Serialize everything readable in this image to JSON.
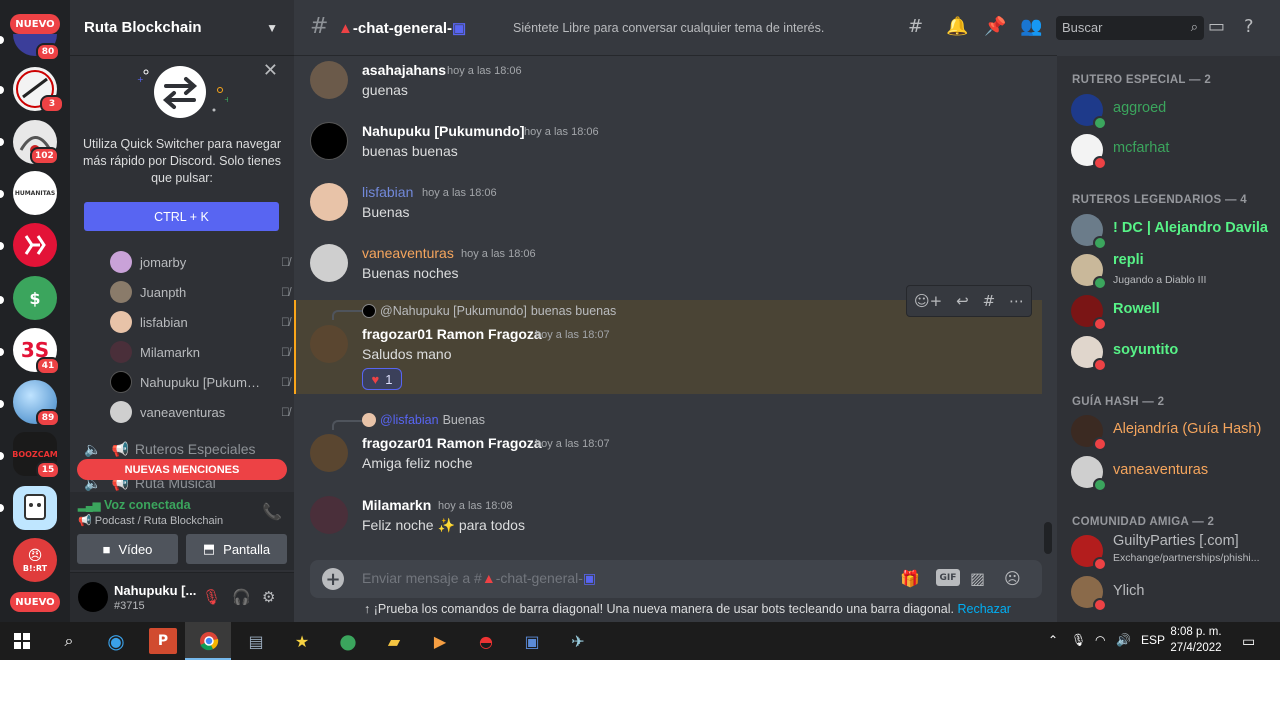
{
  "rail": {
    "nuevo_top": "NUEVO",
    "nuevo_bottom": "NUEVO",
    "badges": [
      "80",
      "3",
      "102",
      "41",
      "89",
      "15"
    ],
    "bhrt_label": "B!:RT"
  },
  "sidebar": {
    "server_name": "Ruta Blockchain",
    "quick_switcher": {
      "text": "Utiliza Quick Switcher para navegar más rápido por Discord. Solo tienes que pulsar:",
      "button": "CTRL + K"
    },
    "voice_users": [
      "jomarby",
      "Juanpth",
      "lisfabian",
      "Milamarkn",
      "Nahupuku [Pukumundo]",
      "vaneaventuras"
    ],
    "channels": [
      "Ruteros Especiales",
      "Ruta Musical"
    ],
    "new_mentions": "NUEVAS MENCIONES",
    "voice_connected": {
      "title": "Voz conectada",
      "subtitle": "Podcast / Ruta Blockchain",
      "video_label": "Vídeo",
      "screen_label": "Pantalla"
    },
    "user": {
      "name": "Nahupuku [...",
      "tag": "#3715"
    }
  },
  "chat": {
    "channel_name": "-chat-general-",
    "topic": "Siéntete Libre para conversar cualquier tema de interés.",
    "search_placeholder": "Buscar",
    "messages": [
      {
        "author": "asahajahans",
        "time": "hoy a las 18:06",
        "text": "guenas"
      },
      {
        "author": "Nahupuku [Pukumundo]",
        "time": "hoy a las 18:06",
        "text": "buenas buenas"
      },
      {
        "author": "lisfabian",
        "time": "hoy a las 18:06",
        "text": "Buenas"
      },
      {
        "author": "vaneaventuras",
        "time": "hoy a las 18:06",
        "text": "Buenas noches"
      },
      {
        "author": "fragozar01 Ramon Fragoza",
        "time": "hoy a las 18:07",
        "text": "Saludos mano",
        "reply_to": "@Nahupuku [Pukumundo]",
        "reply_text": "buenas buenas",
        "reaction_count": "1"
      },
      {
        "author": "fragozar01 Ramon Fragoza",
        "time": "hoy a las 18:07",
        "text": "Amiga feliz noche",
        "reply_to": "@lisfabian",
        "reply_text": "Buenas"
      },
      {
        "author": "Milamarkn",
        "time": "hoy a las 18:08",
        "text_before": "Feliz noche",
        "text_after": "para todos"
      }
    ],
    "composer_placeholder": "Enviar mensaje a #",
    "composer_channel": "-chat-general-",
    "gif_label": "GIF",
    "tip": "¡Prueba los comandos de barra diagonal! Una nueva manera de usar bots tecleando una barra diagonal.",
    "tip_dismiss": "Rechazar"
  },
  "members": {
    "groups": [
      {
        "title": "RUTERO ESPECIAL — 2",
        "members": [
          {
            "name": "aggroed",
            "color": "#3ba55d"
          },
          {
            "name": "mcfarhat",
            "color": "#3ba55d"
          }
        ]
      },
      {
        "title": "RUTEROS LEGENDARIOS — 4",
        "members": [
          {
            "name": "! DC | Alejandro Davila",
            "color": "#57f287"
          },
          {
            "name": "repli",
            "color": "#57f287",
            "activity": "Jugando a Diablo III"
          },
          {
            "name": "Rowell",
            "color": "#57f287"
          },
          {
            "name": "soyuntito",
            "color": "#57f287"
          }
        ]
      },
      {
        "title": "GUÍA HASH — 2",
        "members": [
          {
            "name": "Alejandría (Guía Hash)",
            "color": "#f5a55d"
          },
          {
            "name": "vaneaventuras",
            "color": "#f5a55d"
          }
        ]
      },
      {
        "title": "COMUNIDAD AMIGA — 2",
        "members": [
          {
            "name": "GuiltyParties [.com]",
            "color": "#b9bbbe",
            "activity": "Exchange/partnerships/phishi..."
          },
          {
            "name": "Ylich",
            "color": "#b9bbbe"
          }
        ]
      }
    ]
  },
  "taskbar": {
    "language": "ESP",
    "time": "8:08 p. m.",
    "date": "27/4/2022"
  }
}
